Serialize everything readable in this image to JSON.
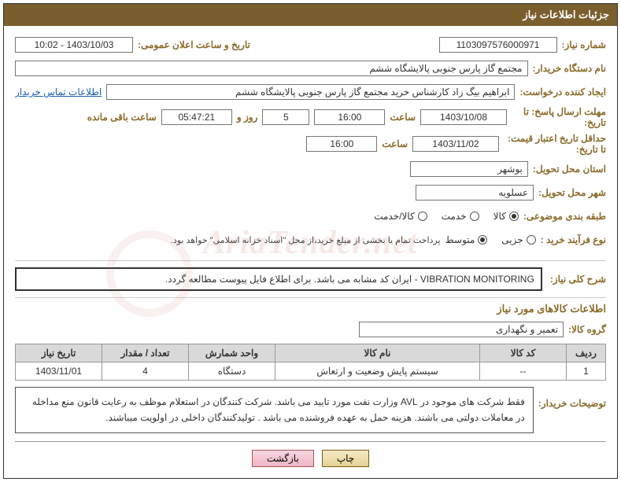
{
  "panel_title": "جزئیات اطلاعات نیاز",
  "watermark": "AriaTender.net",
  "labels": {
    "need_no": "شماره نیاز:",
    "announce_dt": "تاریخ و ساعت اعلان عمومی:",
    "buyer_org": "نام دستگاه خریدار:",
    "requester": "ایجاد کننده درخواست:",
    "buyer_contact": "اطلاعات تماس خریدار",
    "deadline": "مهلت ارسال پاسخ: تا تاریخ:",
    "hour": "ساعت",
    "days_and": "روز و",
    "remaining": "ساعت باقی مانده",
    "validity": "حداقل تاریخ اعتبار قیمت: تا تاریخ:",
    "province": "استان محل تحویل:",
    "city": "شهر محل تحویل:",
    "category": "طبقه بندی موضوعی:",
    "process": "نوع فرآیند خرید :",
    "process_note": "پرداخت تمام یا بخشی از مبلغ خرید،از محل \"اسناد خزانه اسلامی\" خواهد بود.",
    "general_desc": "شرح کلی نیاز:",
    "goods_section": "اطلاعات کالاهای مورد نیاز",
    "goods_group": "گروه کالا:",
    "buyer_notes_lbl": "توضیحات خریدار:",
    "print": "چاپ",
    "back": "بازگشت"
  },
  "values": {
    "need_no": "1103097576000971",
    "announce_dt": "1403/10/03 - 10:02",
    "buyer_org": "مجتمع گاز پارس جنوبی  پالایشگاه ششم",
    "requester": "ابراهیم بیگ زاد کارشناس خرید مجتمع گاز پارس جنوبی  پالایشگاه ششم",
    "deadline_date": "1403/10/08",
    "deadline_time": "16:00",
    "days_left": "5",
    "time_left": "05:47:21",
    "validity_date": "1403/11/02",
    "validity_time": "16:00",
    "province": "بوشهر",
    "city": "عسلویه",
    "general_desc": "VIBRATION MONITORING - ایران کد مشابه می باشد. برای اطلاع فایل پیوست مطالعه گردد.",
    "goods_group": "تعمیر و نگهداری",
    "buyer_notes": "فقط شرکت های موجود در AVL وزارت نفت مورد تایید می باشد. شرکت کنندگان در استعلام موظف به رعایت قانون منع مداخله در معاملات دولتی می باشند. هزینه حمل به عهده فروشنده می باشد . تولیدکنندگان داخلی در اولویت میباشند."
  },
  "category_options": [
    "کالا",
    "خدمت",
    "کالا/خدمت"
  ],
  "category_selected": 0,
  "process_options": [
    "جزیی",
    "متوسط"
  ],
  "process_selected": 1,
  "table": {
    "headers": [
      "ردیف",
      "کد کالا",
      "نام کالا",
      "واحد شمارش",
      "تعداد / مقدار",
      "تاریخ نیاز"
    ],
    "rows": [
      [
        "1",
        "--",
        "سیستم پایش وضعیت و ارتعاش",
        "دستگاه",
        "4",
        "1403/11/01"
      ]
    ]
  }
}
